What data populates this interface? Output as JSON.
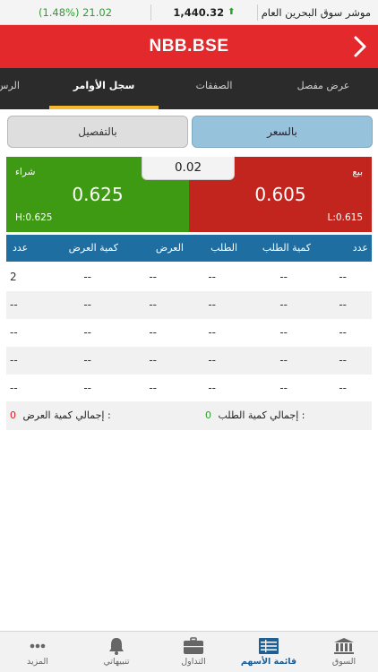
{
  "ticker": {
    "change": "(1.48%) 21.02",
    "value": "1,440.32",
    "index_name": "موشر سوق البحرين العام",
    "arrow": "⬆"
  },
  "header": {
    "title": "NBB.BSE"
  },
  "tabs": [
    {
      "label": "عرض مفصل"
    },
    {
      "label": "الصفقات"
    },
    {
      "label": "سجل الأوامر"
    },
    {
      "label": "الرس"
    }
  ],
  "toggle": {
    "by_price": "بالسعر",
    "detailed": "بالتفصيل"
  },
  "buy": {
    "label": "شراء",
    "price": "0.625",
    "high": "H:0.625"
  },
  "sell": {
    "label": "بيع",
    "price": "0.605",
    "low": "L:0.615"
  },
  "spread": "0.02",
  "table": {
    "headers": {
      "bid_count": "عدد",
      "bid_qty": "كمية الطلب",
      "bid": "الطلب",
      "ask": "العرض",
      "ask_qty": "كمية العرض",
      "ask_count": "عدد"
    },
    "rows": [
      {
        "bid_count": "--",
        "bid_qty": "--",
        "bid": "--",
        "ask": "--",
        "ask_qty": "--",
        "ask_count": "2"
      },
      {
        "bid_count": "--",
        "bid_qty": "--",
        "bid": "--",
        "ask": "--",
        "ask_qty": "--",
        "ask_count": "--"
      },
      {
        "bid_count": "--",
        "bid_qty": "--",
        "bid": "--",
        "ask": "--",
        "ask_qty": "--",
        "ask_count": "--"
      },
      {
        "bid_count": "--",
        "bid_qty": "--",
        "bid": "--",
        "ask": "--",
        "ask_qty": "--",
        "ask_count": "--"
      },
      {
        "bid_count": "--",
        "bid_qty": "--",
        "bid": "--",
        "ask": "--",
        "ask_qty": "--",
        "ask_count": "--"
      }
    ]
  },
  "totals": {
    "bid_label": "إجمالي كمية الطلب :",
    "bid_value": "0",
    "ask_label": "إجمالي كمية العرض :",
    "ask_value": "0"
  },
  "tabbar": [
    {
      "label": "السوق",
      "icon": "bank-icon"
    },
    {
      "label": "قائمة الأسهم",
      "icon": "list-icon"
    },
    {
      "label": "التداول",
      "icon": "briefcase-icon"
    },
    {
      "label": "تنبيهاتي",
      "icon": "bell-icon"
    },
    {
      "label": "المزيد",
      "icon": "more-icon"
    }
  ],
  "colors": {
    "header_red": "#e3292b",
    "buy_green": "#3e9a12",
    "sell_red": "#c2241e",
    "table_header_blue": "#1e6ea1",
    "tab_underline": "#f5b82e",
    "active_tab_blue": "#1e5f94"
  }
}
